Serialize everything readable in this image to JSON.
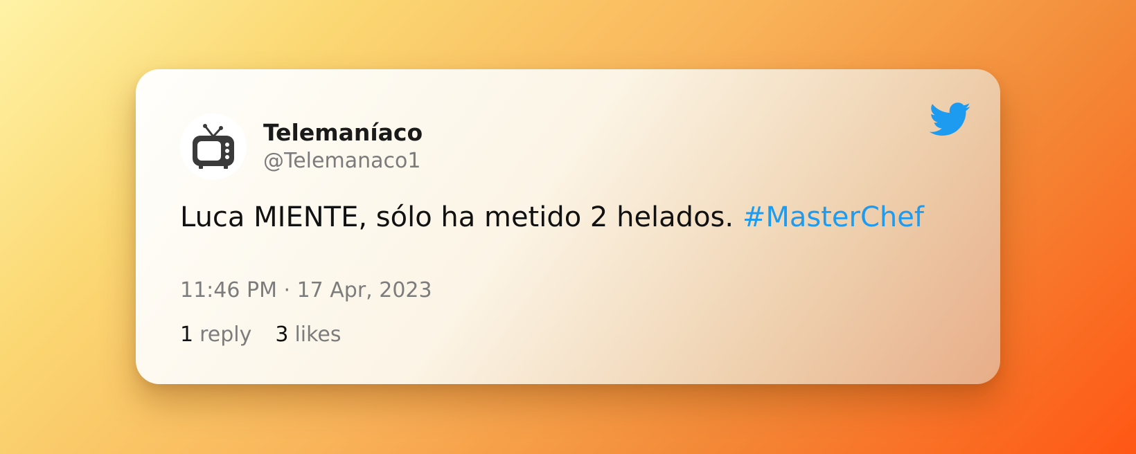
{
  "tweet": {
    "author": {
      "display_name": "Telemaníaco",
      "handle": "@Telemanaco1",
      "avatar_icon": "retro-tv-icon"
    },
    "text": "Luca MIENTE, sólo ha metido 2 helados.",
    "hashtag": "#MasterChef",
    "timestamp": "11:46 PM · 17 Apr, 2023",
    "stats": {
      "replies_count": "1",
      "replies_label": "reply",
      "likes_count": "3",
      "likes_label": "likes"
    },
    "brand_icon": "twitter-bird-icon"
  },
  "colors": {
    "hashtag": "#1d9bf0",
    "twitter_blue": "#1d9bf0",
    "muted_text": "#7c7c7c",
    "main_text": "#111111"
  }
}
